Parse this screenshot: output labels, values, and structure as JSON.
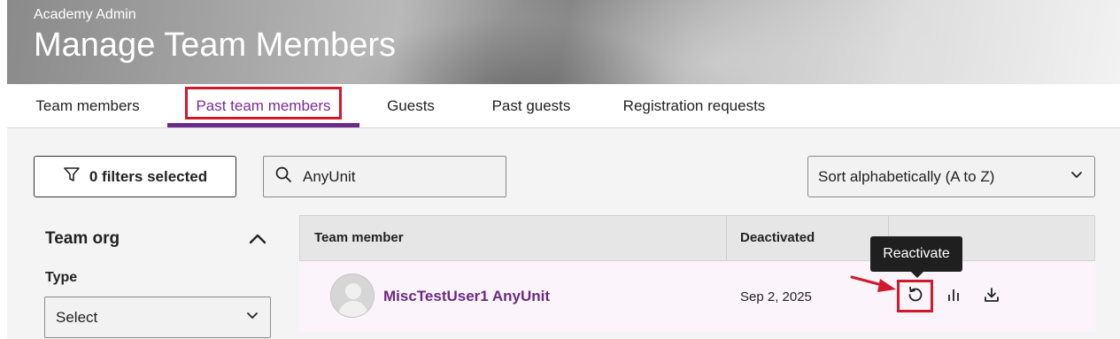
{
  "header": {
    "subtitle": "Academy Admin",
    "title": "Manage Team Members"
  },
  "tabs": [
    {
      "label": "Team members",
      "active": false
    },
    {
      "label": "Past team members",
      "active": true
    },
    {
      "label": "Guests",
      "active": false
    },
    {
      "label": "Past guests",
      "active": false
    },
    {
      "label": "Registration requests",
      "active": false
    }
  ],
  "toolbar": {
    "filters_label": "0 filters selected",
    "search_value": "AnyUnit",
    "sort_value": "Sort alphabetically (A to Z)"
  },
  "sidebar": {
    "section_title": "Team org",
    "type_label": "Type",
    "type_value": "Select"
  },
  "table": {
    "columns": [
      "Team member",
      "Deactivated",
      ""
    ],
    "rows": [
      {
        "name": "MiscTestUser1 AnyUnit",
        "deactivated": "Sep 2, 2025"
      }
    ]
  },
  "tooltip": {
    "text": "Reactivate"
  },
  "icons": {
    "filter": "filter-icon",
    "search": "search-icon",
    "sort_dropdown": "chevron-down-icon",
    "section_toggle": "chevron-up-icon",
    "type_dropdown": "chevron-down-icon",
    "reactivate": "reactivate-icon",
    "stats": "bar-chart-icon",
    "download": "download-icon"
  },
  "colors": {
    "accent": "#6b2b8b",
    "highlight": "#d0192b",
    "row_background": "#fbf4fb"
  }
}
